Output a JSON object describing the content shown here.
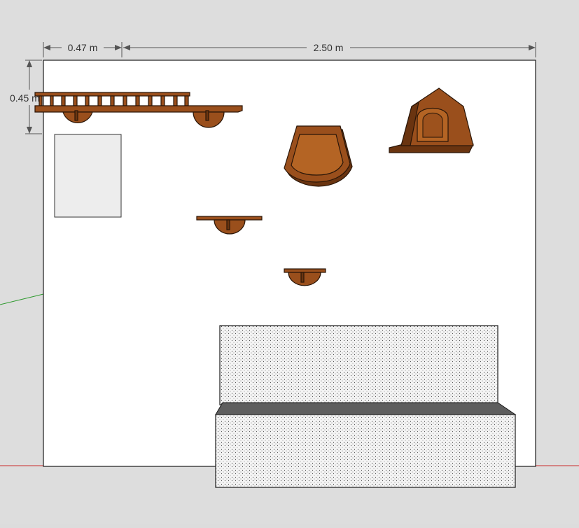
{
  "dimensions": {
    "width_small": "0.47 m",
    "width_wall": "2.50 m",
    "height_shelf": "0.45 m"
  },
  "colors": {
    "background": "#dddddd",
    "wall": "#ffffff",
    "wood": "#9a4f1c",
    "sofa_fabric": "#f4f4f4",
    "sofa_shadow": "#5e5e5e",
    "axis_red": "#cc2a2a",
    "axis_green": "#2e9a2e"
  },
  "scene": {
    "objects": [
      "wall",
      "wall-frame",
      "ladder-bridge-shelf",
      "cat-bed-basket",
      "cat-house",
      "step-shelf-middle",
      "step-shelf-lower",
      "sofa"
    ]
  }
}
